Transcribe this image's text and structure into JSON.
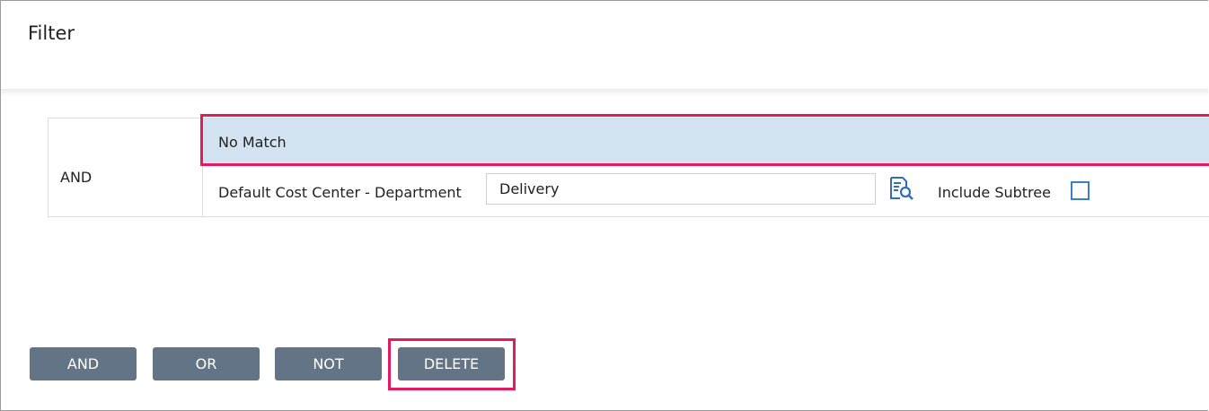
{
  "header": {
    "title": "Filter"
  },
  "filter": {
    "operator_label": "AND",
    "no_match_label": "No Match",
    "condition": {
      "field_label": "Default Cost Center - Department",
      "value": "Delivery",
      "lookup_icon": "lookup-search-icon",
      "subtree_label": "Include Subtree",
      "subtree_checked": false
    }
  },
  "actions": {
    "and_label": "AND",
    "or_label": "OR",
    "not_label": "NOT",
    "delete_label": "DELETE"
  },
  "colors": {
    "highlight": "#e5195e",
    "selected_row": "#d3e3f2",
    "button_bg": "#637487",
    "checkbox_border": "#3b7dc9",
    "icon_blue": "#2f6fb8"
  }
}
